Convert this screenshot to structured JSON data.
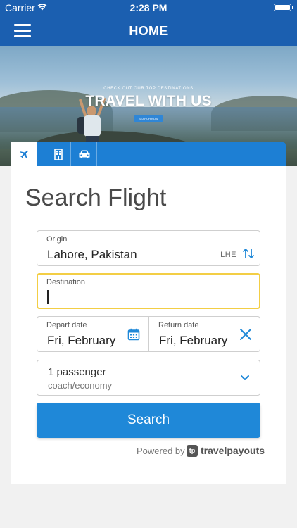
{
  "status_bar": {
    "carrier": "Carrier",
    "time": "2:28 PM"
  },
  "nav": {
    "title": "HOME",
    "menu_icon": "hamburger-menu-icon"
  },
  "hero": {
    "small_text": "CHECK OUT OUR TOP DESTINATIONS",
    "title": "TRAVEL WITH US",
    "button_label": "SEARCH NOW"
  },
  "tabs": [
    {
      "icon": "airplane-icon",
      "active": true
    },
    {
      "icon": "hotel-building-icon",
      "active": false
    },
    {
      "icon": "car-icon",
      "active": false
    }
  ],
  "form": {
    "heading": "Search Flight",
    "origin": {
      "label": "Origin",
      "value": "Lahore, Pakistan",
      "code": "LHE"
    },
    "destination": {
      "label": "Destination",
      "value": ""
    },
    "depart": {
      "label": "Depart date",
      "value": "Fri, February"
    },
    "return": {
      "label": "Return date",
      "value": "Fri, February"
    },
    "passengers": {
      "count": "1 passenger",
      "class": "coach/economy"
    },
    "search_label": "Search"
  },
  "footer": {
    "powered_by": "Powered by",
    "brand": "travelpayouts"
  },
  "colors": {
    "primary": "#1b5fb0",
    "accent": "#1f88d8",
    "focus": "#f3ce45"
  }
}
